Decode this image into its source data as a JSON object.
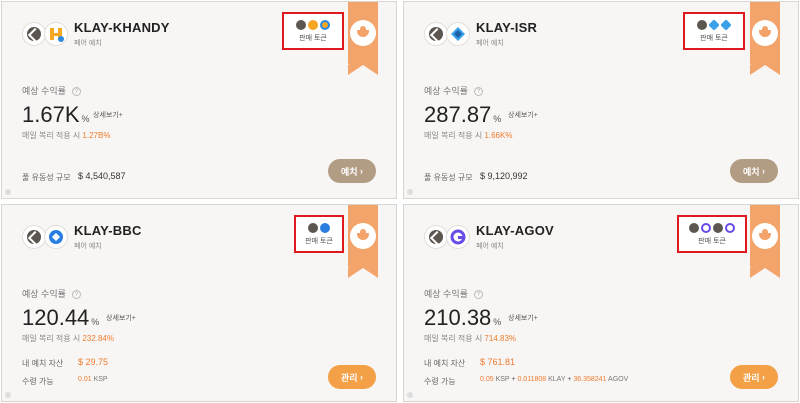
{
  "colors": {
    "accent": "#f3a46a",
    "brown_button": "#b29d84",
    "orange_button": "#f3a046",
    "highlight_box": "#e0191f",
    "value_orange": "#ee7b2e"
  },
  "common": {
    "subtitle": "페어 예치",
    "sell_token_label": "판매 토큰",
    "yield_label": "예상 수익률",
    "help_icon": "?",
    "percent": "%",
    "detail_link": "상세보기+",
    "compound_prefix": "매일 복리 적용 시",
    "pool_label": "풀 유동성 규모",
    "deposit_button": "예치",
    "manage_button": "관리",
    "my_deposit_label": "내 예치 자산",
    "claimable_label": "수령 가능",
    "arrow": "›"
  },
  "cards": [
    {
      "title": "KLAY-KHANDY",
      "yield": "1.67K",
      "compound": "1.27B%",
      "pool_value": "$ 4,540,587",
      "icons": [
        "klay-coin-icon",
        "khandy-coin-icon"
      ]
    },
    {
      "title": "KLAY-ISR",
      "yield": "287.87",
      "compound": "1.66K%",
      "pool_value": "$ 9,120,992",
      "icons": [
        "klay-coin-icon",
        "isr-coin-icon"
      ]
    },
    {
      "title": "KLAY-BBC",
      "yield": "120.44",
      "compound": "232.84%",
      "my_deposit": "$ 29.75",
      "claim": {
        "a": "0.01",
        "a_unit": "KSP"
      },
      "icons": [
        "klay-coin-icon",
        "bbc-coin-icon"
      ]
    },
    {
      "title": "KLAY-AGOV",
      "yield": "210.38",
      "compound": "714.83%",
      "my_deposit": "$ 761.81",
      "claim": {
        "a": "0.05",
        "a_unit": "KSP",
        "b": "0.011808",
        "b_unit": "KLAY",
        "c": "36.358241",
        "c_unit": "AGOV",
        "plus": "+"
      },
      "icons": [
        "klay-coin-icon",
        "agov-coin-icon"
      ]
    }
  ]
}
